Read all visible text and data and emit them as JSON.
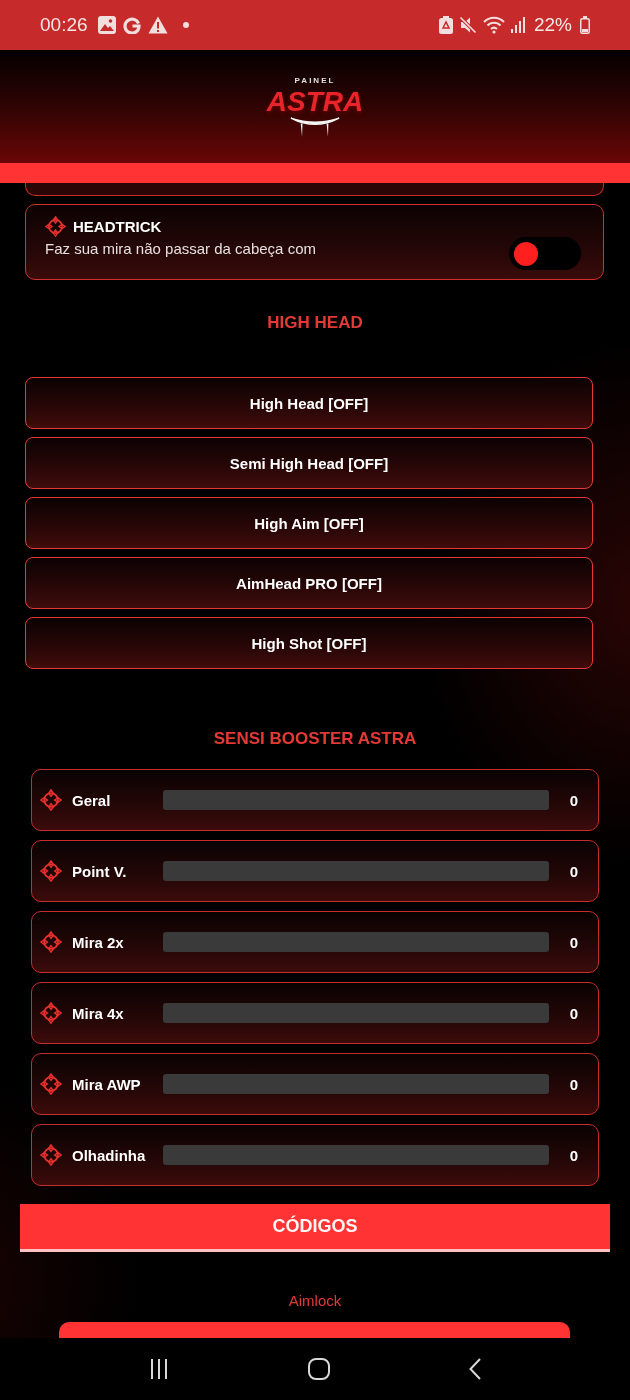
{
  "status_bar": {
    "time": "00:26",
    "battery": "22%"
  },
  "header": {
    "logo_small": "PAINEL",
    "logo_large": "ASTRA"
  },
  "features": [
    {
      "title": "HEADTRICK",
      "description": "Faz sua mira não passar da cabeça com",
      "on": false
    }
  ],
  "high_head": {
    "title": "HIGH HEAD",
    "buttons": [
      {
        "label": "High Head [OFF]"
      },
      {
        "label": "Semi High Head [OFF]"
      },
      {
        "label": "High Aim [OFF]"
      },
      {
        "label": "AimHead PRO [OFF]"
      },
      {
        "label": "High Shot [OFF]"
      }
    ]
  },
  "sensi": {
    "title": "SENSI BOOSTER ASTRA",
    "sliders": [
      {
        "label": "Geral",
        "reading": "0"
      },
      {
        "label": "Point V.",
        "reading": "0"
      },
      {
        "label": "Mira 2x",
        "reading": "0"
      },
      {
        "label": "Mira 4x",
        "reading": "0"
      },
      {
        "label": "Mira AWP",
        "reading": "0"
      },
      {
        "label": "Olhadinha",
        "reading": "0"
      }
    ]
  },
  "codes": {
    "title": "CÓDIGOS",
    "items": [
      {
        "label": "Aimlock"
      }
    ]
  }
}
